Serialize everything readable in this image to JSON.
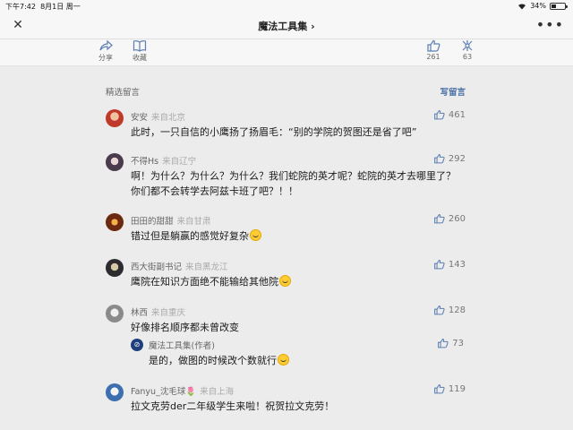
{
  "status": {
    "time": "下午7:42",
    "date": "8月1日 周一",
    "battery": "34%",
    "battery_level": 0.34
  },
  "nav": {
    "title": "魔法工具集 ›",
    "close": "✕",
    "more": "•••"
  },
  "actions": {
    "share": "分享",
    "favorite": "收藏",
    "like_count": "261",
    "dislike_count": "63"
  },
  "comments_header": {
    "title": "精选留言",
    "write": "写留言"
  },
  "comments": [
    {
      "name": "安安",
      "source": "来自北京",
      "likes": "461",
      "text": "此时，一只自信的小鹰扬了扬眉毛：“别的学院的贺图还是省了吧”"
    },
    {
      "name": "不得Hs",
      "source": "来自辽宁",
      "likes": "292",
      "text": "啊！为什么？为什么？为什么？我们蛇院的英才呢？蛇院的英才去哪里了？你们都不会转学去阿兹卡班了吧？！！"
    },
    {
      "name": "田田的甜甜",
      "source": "来自甘肃",
      "likes": "260",
      "text": "错过但是躺赢的感觉好复杂"
    },
    {
      "name": "西大街副书记",
      "source": "来自黑龙江",
      "likes": "143",
      "text": "鹰院在知识方面绝不能输给其他院"
    },
    {
      "name": "林西",
      "source": "来自重庆",
      "likes": "128",
      "text": "好像排名顺序都未曾改变",
      "reply": {
        "name": "魔法工具集(作者)",
        "likes": "73",
        "text": "是的，做图的时候改个数就行"
      }
    },
    {
      "name": "Fanyu_沈毛球🌷",
      "source": "来自上海",
      "likes": "119",
      "text": "拉文克劳der二年级学生来啦！祝贺拉文克劳！"
    }
  ]
}
